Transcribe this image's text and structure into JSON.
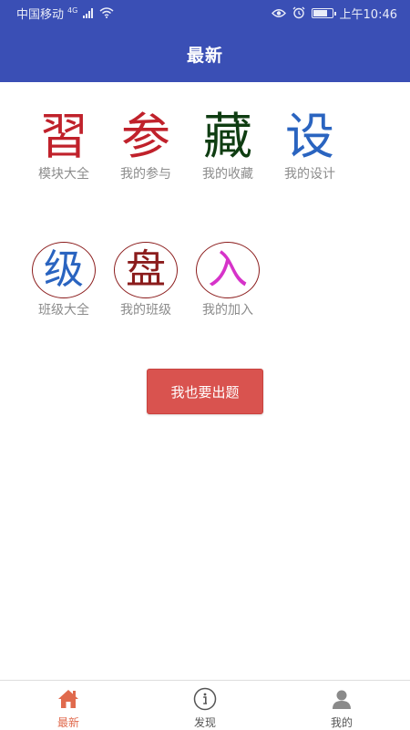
{
  "status_bar": {
    "carrier": "中国移动",
    "network": "4G",
    "time": "上午10:46",
    "icons": [
      "signal-icon",
      "wifi-icon",
      "eye-icon",
      "alarm-icon",
      "battery-icon"
    ],
    "battery_level": 0.75
  },
  "header": {
    "title": "最新"
  },
  "tiles": [
    {
      "glyph": "習",
      "label": "模块大全",
      "color": "#c0212b"
    },
    {
      "glyph": "参",
      "label": "我的参与",
      "color": "#c0212b"
    },
    {
      "glyph": "藏",
      "label": "我的收藏",
      "color": "#0f3d12"
    },
    {
      "glyph": "设",
      "label": "我的设计",
      "color": "#2a64c0"
    },
    {
      "glyph": "级",
      "label": "班级大全",
      "color": "#2a64c0"
    },
    {
      "glyph": "盘",
      "label": "我的班级",
      "color": "#8b1c1c"
    },
    {
      "glyph": "入",
      "label": "我的加入",
      "color": "#d633c9"
    }
  ],
  "action_button": {
    "label": "我也要出题",
    "color": "#d9534f"
  },
  "bottom_nav": {
    "items": [
      {
        "label": "最新",
        "icon": "home-icon",
        "active": true
      },
      {
        "label": "发现",
        "icon": "info-icon",
        "active": false
      },
      {
        "label": "我的",
        "icon": "person-icon",
        "active": false
      }
    ],
    "active_color": "#e06a4d"
  },
  "colors": {
    "primary": "#3a4fb5",
    "circle_border": "#8b1c1c"
  }
}
